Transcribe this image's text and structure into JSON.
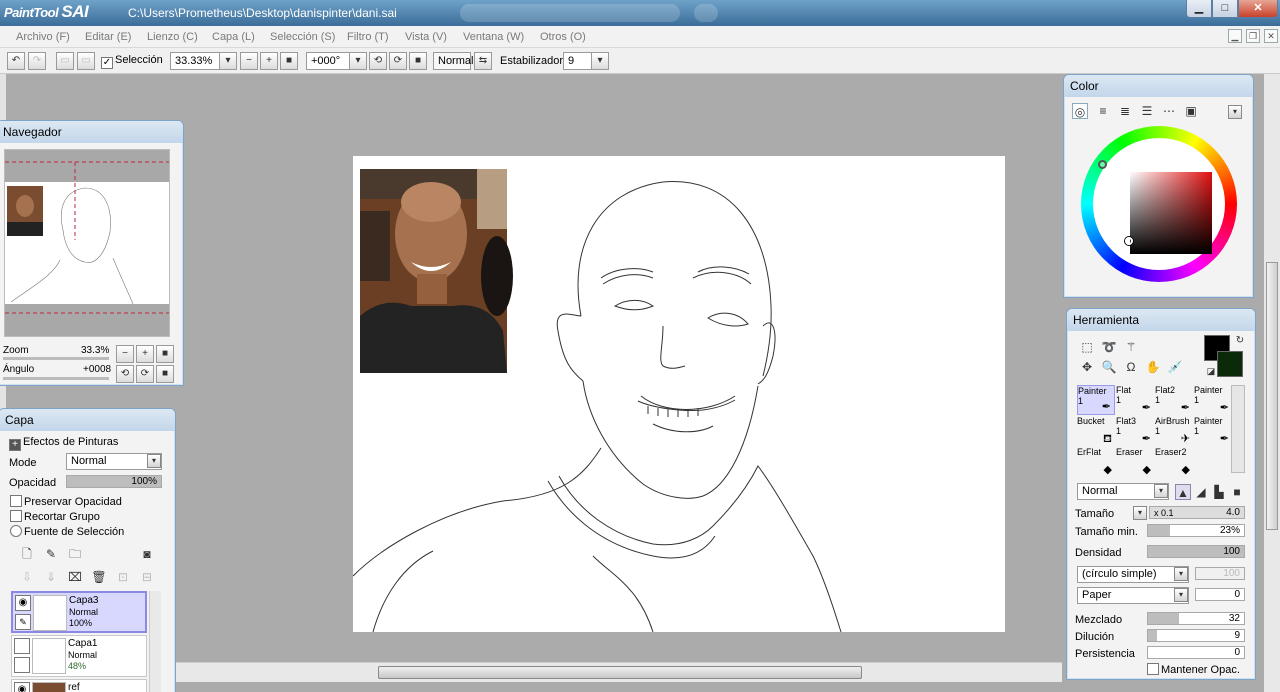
{
  "titlebar": {
    "logo_text": "PaintTool",
    "logo_sai": "SAI",
    "path": "C:\\Users\\Prometheus\\Desktop\\danispinter\\dani.sai",
    "min_icon": "minimize-icon",
    "max_icon": "maximize-icon",
    "close_icon": "close-icon"
  },
  "menu": {
    "items": [
      "Archivo (F)",
      "Editar (E)",
      "Lienzo (C)",
      "Capa (L)",
      "Selección (S)",
      "Filtro (T)",
      "Vista (V)",
      "Ventana (W)",
      "Otros (O)"
    ]
  },
  "toolbar": {
    "selection_label": "Selección",
    "zoom": "33.33%",
    "angle": "+000°",
    "mode": "Normal",
    "stabilizer_label": "Estabilizador",
    "stabilizer_value": "9"
  },
  "navigator": {
    "title": "Navegador",
    "zoom_label": "Zoom",
    "zoom_value": "33.3%",
    "angle_label": "Ángulo",
    "angle_value": "+0008"
  },
  "capa": {
    "title": "Capa",
    "effects_label": "Efectos de Pinturas",
    "mode_label": "Mode",
    "mode_value": "Normal",
    "opacity_label": "Opacidad",
    "opacity_value": "100%",
    "preserve_label": "Preservar Opacidad",
    "clip_label": "Recortar Grupo",
    "source_label": "Fuente de Selección",
    "layers": [
      {
        "name": "Capa3",
        "mode": "Normal",
        "opacity": "100%"
      },
      {
        "name": "Capa1",
        "mode": "Normal",
        "opacity": "48%"
      },
      {
        "name": "ref",
        "mode": "",
        "opacity": ""
      }
    ]
  },
  "color": {
    "title": "Color"
  },
  "tool": {
    "title": "Herramienta",
    "brushes": [
      {
        "name": "Painter",
        "size": "1"
      },
      {
        "name": "Flat",
        "size": "1"
      },
      {
        "name": "Flat2",
        "size": "1"
      },
      {
        "name": "Painter",
        "size": "1"
      },
      {
        "name": "Bucket",
        "size": ""
      },
      {
        "name": "Flat3",
        "size": "1"
      },
      {
        "name": "AirBrush",
        "size": "1"
      },
      {
        "name": "Painter",
        "size": "1"
      },
      {
        "name": "ErFlat",
        "size": ""
      },
      {
        "name": "Eraser",
        "size": ""
      },
      {
        "name": "Eraser2",
        "size": ""
      }
    ],
    "blend_mode": "Normal",
    "size_label": "Tamaño",
    "size_mult": "x 0.1",
    "size_value": "4.0",
    "min_size_label": "Tamaño min.",
    "min_size_value": "23%",
    "density_label": "Densidad",
    "density_value": "100",
    "shape": "(círculo simple)",
    "shape_value": "100",
    "texture": "Paper",
    "texture_value": "0",
    "mix_label": "Mezclado",
    "mix_value": "32",
    "dilution_label": "Dilución",
    "dilution_value": "9",
    "persistence_label": "Persistencia",
    "persistence_value": "0",
    "keep_opacity_label": "Mantener Opac."
  }
}
